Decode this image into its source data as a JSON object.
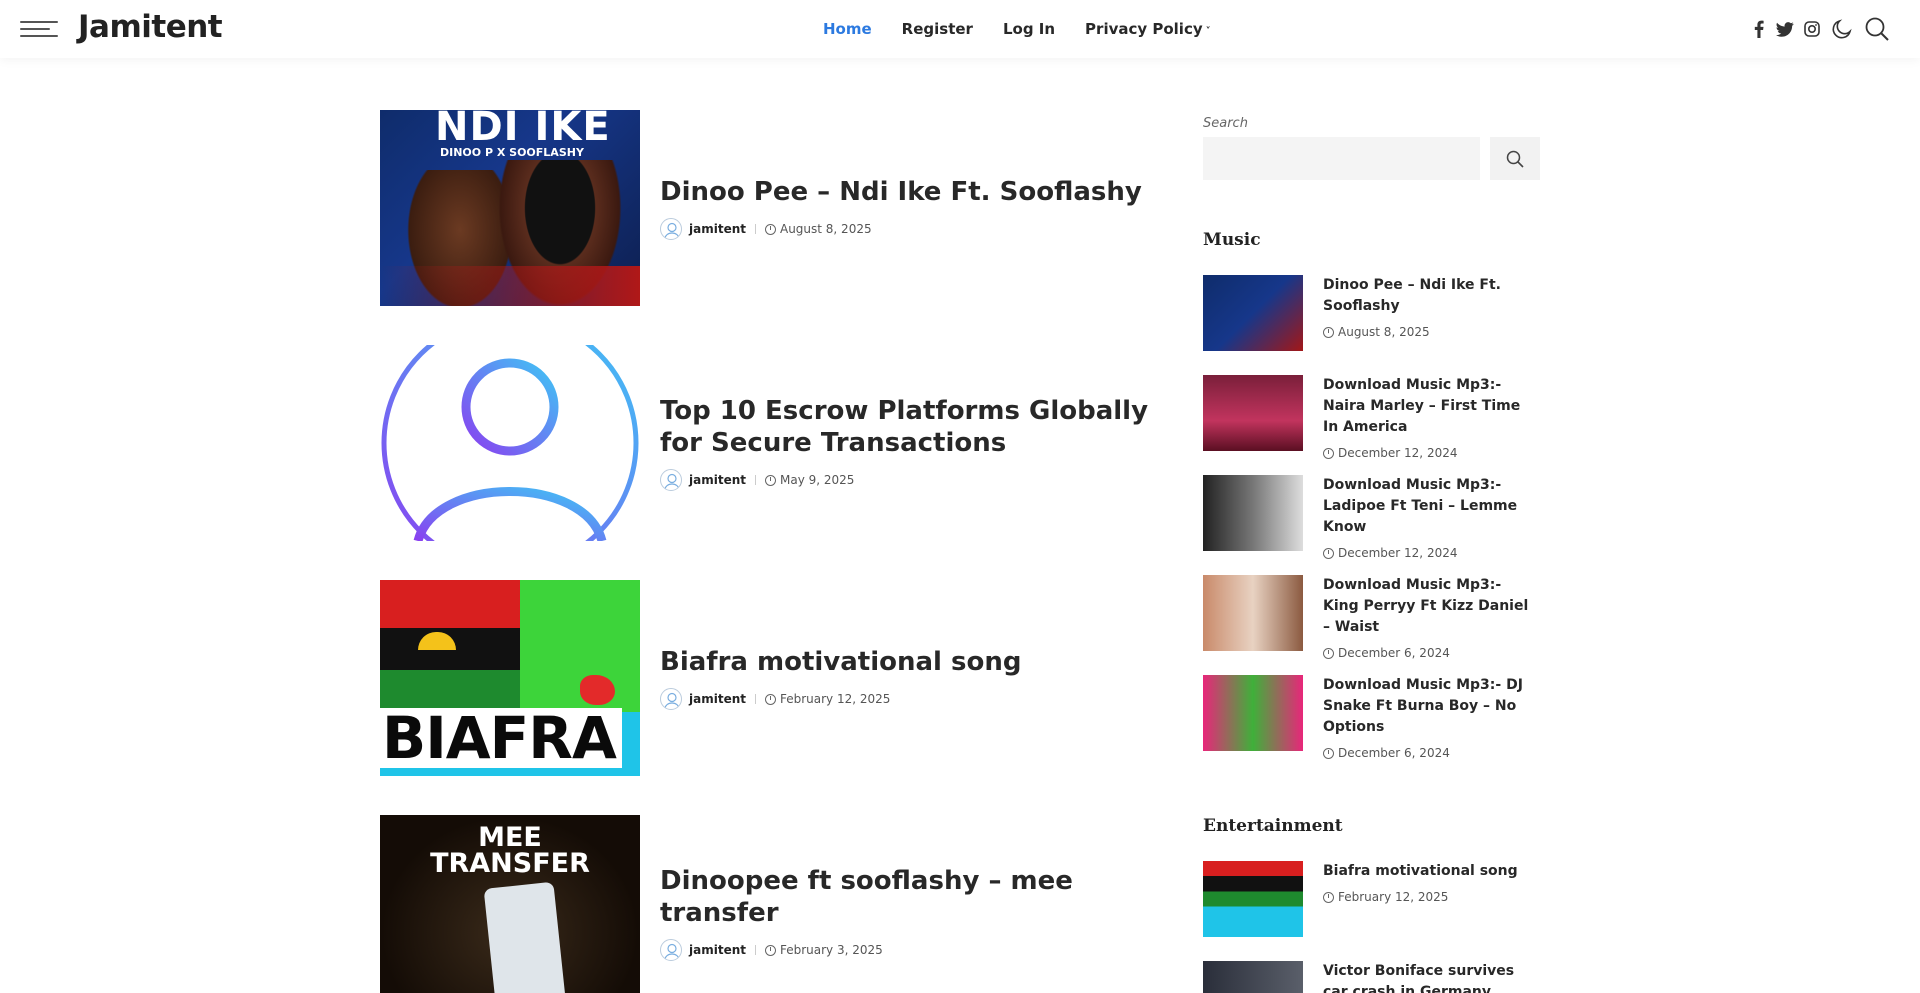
{
  "header": {
    "logo": "Jamitent",
    "nav": [
      {
        "label": "Home",
        "active": true
      },
      {
        "label": "Register",
        "active": false
      },
      {
        "label": "Log In",
        "active": false
      },
      {
        "label": "Privacy Policy",
        "active": false,
        "has_dropdown": true
      }
    ],
    "icons": [
      "facebook-icon",
      "twitter-icon",
      "instagram-icon",
      "dark-mode-icon",
      "search-icon"
    ],
    "accent_color": "#2c7ae0"
  },
  "posts": [
    {
      "title": "Dinoo Pee – Ndi Ike Ft. Sooflashy",
      "author": "jamitent",
      "date": "August 8, 2025",
      "thumb_text": "NDI IKE",
      "thumb_sub": "DINOO P X SOOFLASHY"
    },
    {
      "title": "Top 10 Escrow Platforms Globally for Secure Transactions",
      "author": "jamitent",
      "date": "May 9, 2025"
    },
    {
      "title": "Biafra motivational song",
      "author": "jamitent",
      "date": "February 12, 2025",
      "thumb_text": "BIAFRA"
    },
    {
      "title": "Dinoopee ft sooflashy – mee transfer",
      "author": "jamitent",
      "date": "February 3, 2025",
      "thumb_text": "MEE TRANSFER"
    }
  ],
  "sidebar": {
    "search_label": "Search",
    "search_placeholder": "",
    "music_title": "Music",
    "music": [
      {
        "title": "Dinoo Pee – Ndi Ike Ft. Sooflashy",
        "date": "August 8, 2025"
      },
      {
        "title": "Download Music Mp3:- Naira Marley – First Time In America",
        "date": "December 12, 2024"
      },
      {
        "title": "Download Music Mp3:- Ladipoe Ft Teni – Lemme Know",
        "date": "December 12, 2024"
      },
      {
        "title": "Download Music Mp3:- King Perryy Ft Kizz Daniel – Waist",
        "date": "December 6, 2024"
      },
      {
        "title": "Download Music Mp3:- DJ Snake Ft Burna Boy – No Options",
        "date": "December 6, 2024"
      }
    ],
    "entertainment_title": "Entertainment",
    "entertainment": [
      {
        "title": "Biafra motivational song",
        "date": "February 12, 2025"
      },
      {
        "title": "Victor Boniface survives car crash in Germany",
        "date": ""
      }
    ]
  }
}
